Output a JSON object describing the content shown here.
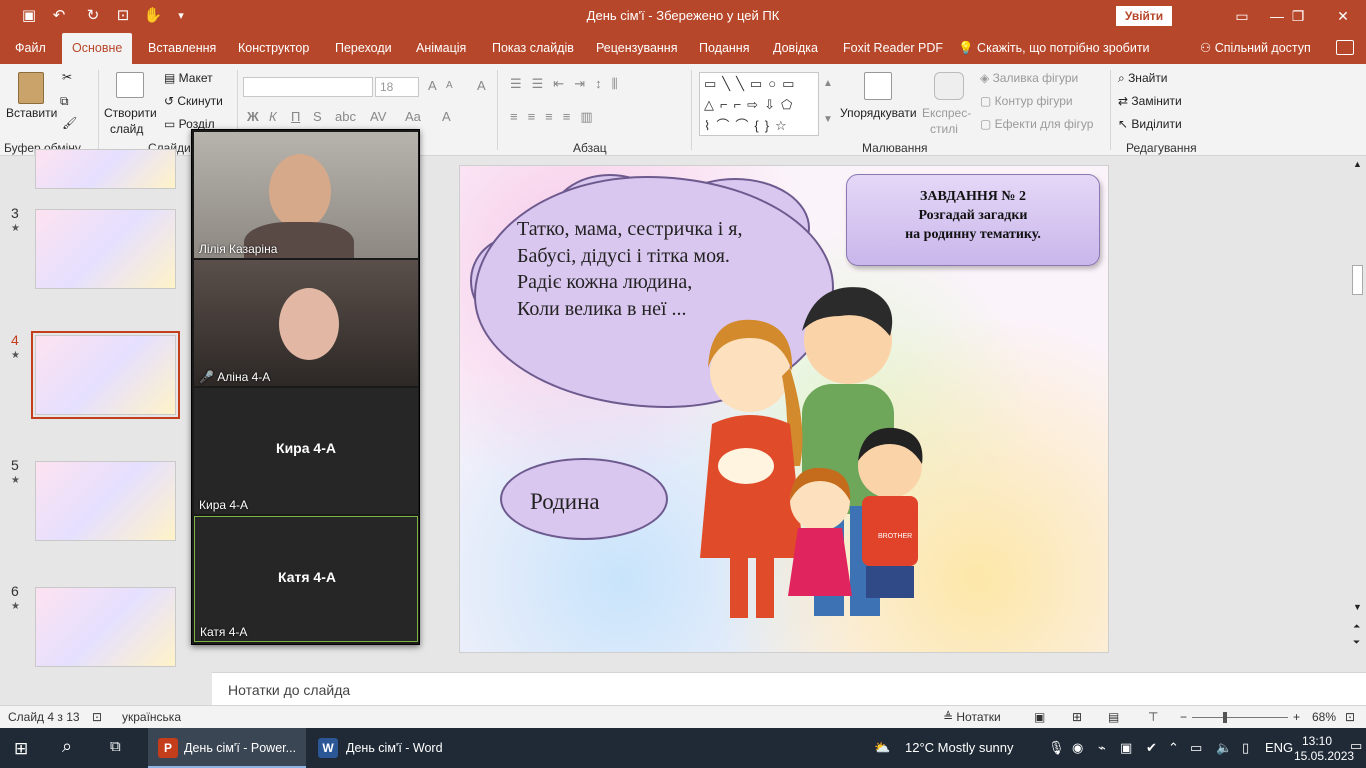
{
  "titlebar": {
    "title": "День сім'ї  -  Збережено у цей ПК",
    "signin": "Увійти",
    "icons": [
      "save-icon",
      "undo-icon",
      "redo-icon",
      "present-icon",
      "touch-mode-icon",
      "customize-icon"
    ]
  },
  "tabs": [
    {
      "label": "Файл"
    },
    {
      "label": "Основне"
    },
    {
      "label": "Вставлення"
    },
    {
      "label": "Конструктор"
    },
    {
      "label": "Переходи"
    },
    {
      "label": "Анімація"
    },
    {
      "label": "Показ слайдів"
    },
    {
      "label": "Рецензування"
    },
    {
      "label": "Подання"
    },
    {
      "label": "Довідка"
    },
    {
      "label": "Foxit Reader PDF"
    }
  ],
  "tellme": "Скажіть, що потрібно зробити",
  "share": "Спільний доступ",
  "ribbon": {
    "clipboard": {
      "paste": "Вставити",
      "label": "Буфер обміну"
    },
    "slides": {
      "new_slide": "Створити",
      "new_slide2": "слайд",
      "layout": "Макет",
      "reset": "Скинути",
      "section": "Розділ",
      "label": "Слайди"
    },
    "font": {
      "size": "18",
      "bold": "Ж",
      "italic": "К",
      "underline": "П",
      "shadow": "S"
    },
    "paragraph": {
      "label": "Абзац"
    },
    "drawing": {
      "arrange": "Упорядкувати",
      "quick_styles": "Експрес-",
      "quick_styles2": "стилі",
      "fill": "Заливка фігури",
      "outline": "Контур фігури",
      "effects": "Ефекти для фігур",
      "label": "Малювання"
    },
    "editing": {
      "find": "Знайти",
      "replace": "Замінити",
      "select": "Виділити",
      "label": "Редагування"
    }
  },
  "thumbnails": [
    {
      "num": "3"
    },
    {
      "num": "4"
    },
    {
      "num": "5"
    },
    {
      "num": "6"
    }
  ],
  "video": {
    "participants": [
      {
        "name": "Лілія Казаріна"
      },
      {
        "name": "Аліна 4-А"
      },
      {
        "name": "Кира 4-А",
        "center": "Кира 4-А"
      },
      {
        "name": "Катя  4-А",
        "center": "Катя  4-А"
      }
    ]
  },
  "slide": {
    "riddle_lines": [
      "Татко, мама, сестричка і я,",
      "Бабусі, дідусі і тітка моя.",
      "Радіє кожна людина,",
      "Коли велика в неї ..."
    ],
    "task_title": "ЗАВДАННЯ № 2",
    "task_line1": "Розгадай загадки",
    "task_line2": "на родинну тематику.",
    "answer": "Родина",
    "shirt_text": "BROTHER"
  },
  "notes": {
    "placeholder": "Нотатки до слайда"
  },
  "status": {
    "slide_info": "Слайд 4 з 13",
    "language": "українська",
    "notes_btn": "Нотатки",
    "zoom": "68%"
  },
  "zoom_level": 0.68,
  "taskbar": {
    "apps": [
      {
        "label": "День сім'ї - Power..."
      },
      {
        "label": "День сім'ї - Word"
      }
    ],
    "weather": "12°C  Mostly sunny",
    "lang": "ENG",
    "time": "13:10",
    "date": "15.05.2023"
  },
  "colors": {
    "accent": "#b7472a",
    "selected": "#c43e1c",
    "cloud": "#d9c7ef"
  }
}
